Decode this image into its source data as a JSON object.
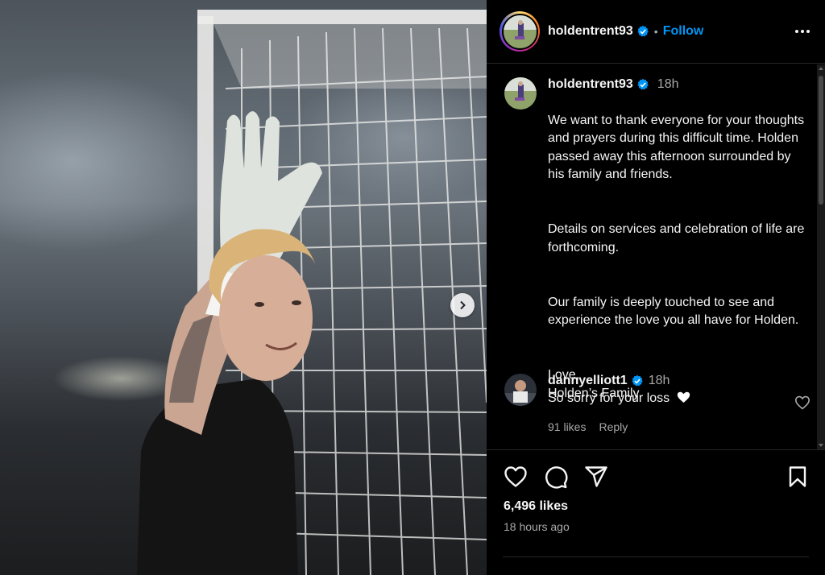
{
  "post": {
    "username": "holdentrent93",
    "follow_label": "Follow",
    "separator": "•",
    "caption": {
      "username": "holdentrent93",
      "time": "18h",
      "paragraphs": [
        "We want to thank everyone for your thoughts and prayers during this difficult time. Holden passed away this afternoon surrounded by his family and friends.",
        "Details on services and celebration of life are forthcoming.",
        "Our family is deeply touched to see and experience the love you all have for Holden.",
        "Love,\nHolden’s Family"
      ]
    },
    "comment": {
      "username": "dannyelliott1",
      "time": "18h",
      "text": "So sorry for your loss",
      "likes": "91 likes",
      "reply_label": "Reply"
    },
    "likes_count": "6,496 likes",
    "posted_ago": "18 hours ago"
  },
  "colors": {
    "background": "#000000",
    "text": "#f5f5f5",
    "muted": "#a8a8a8",
    "link_blue": "#0095f6",
    "verified_blue": "#0095f6",
    "divider": "#262626"
  },
  "icons": {
    "verified": "verified-badge-icon",
    "more": "more-horizontal-icon",
    "next": "chevron-right-icon",
    "like": "heart-icon",
    "comment": "comment-icon",
    "share": "paper-plane-icon",
    "save": "bookmark-icon",
    "comment_like": "small-heart-icon"
  }
}
